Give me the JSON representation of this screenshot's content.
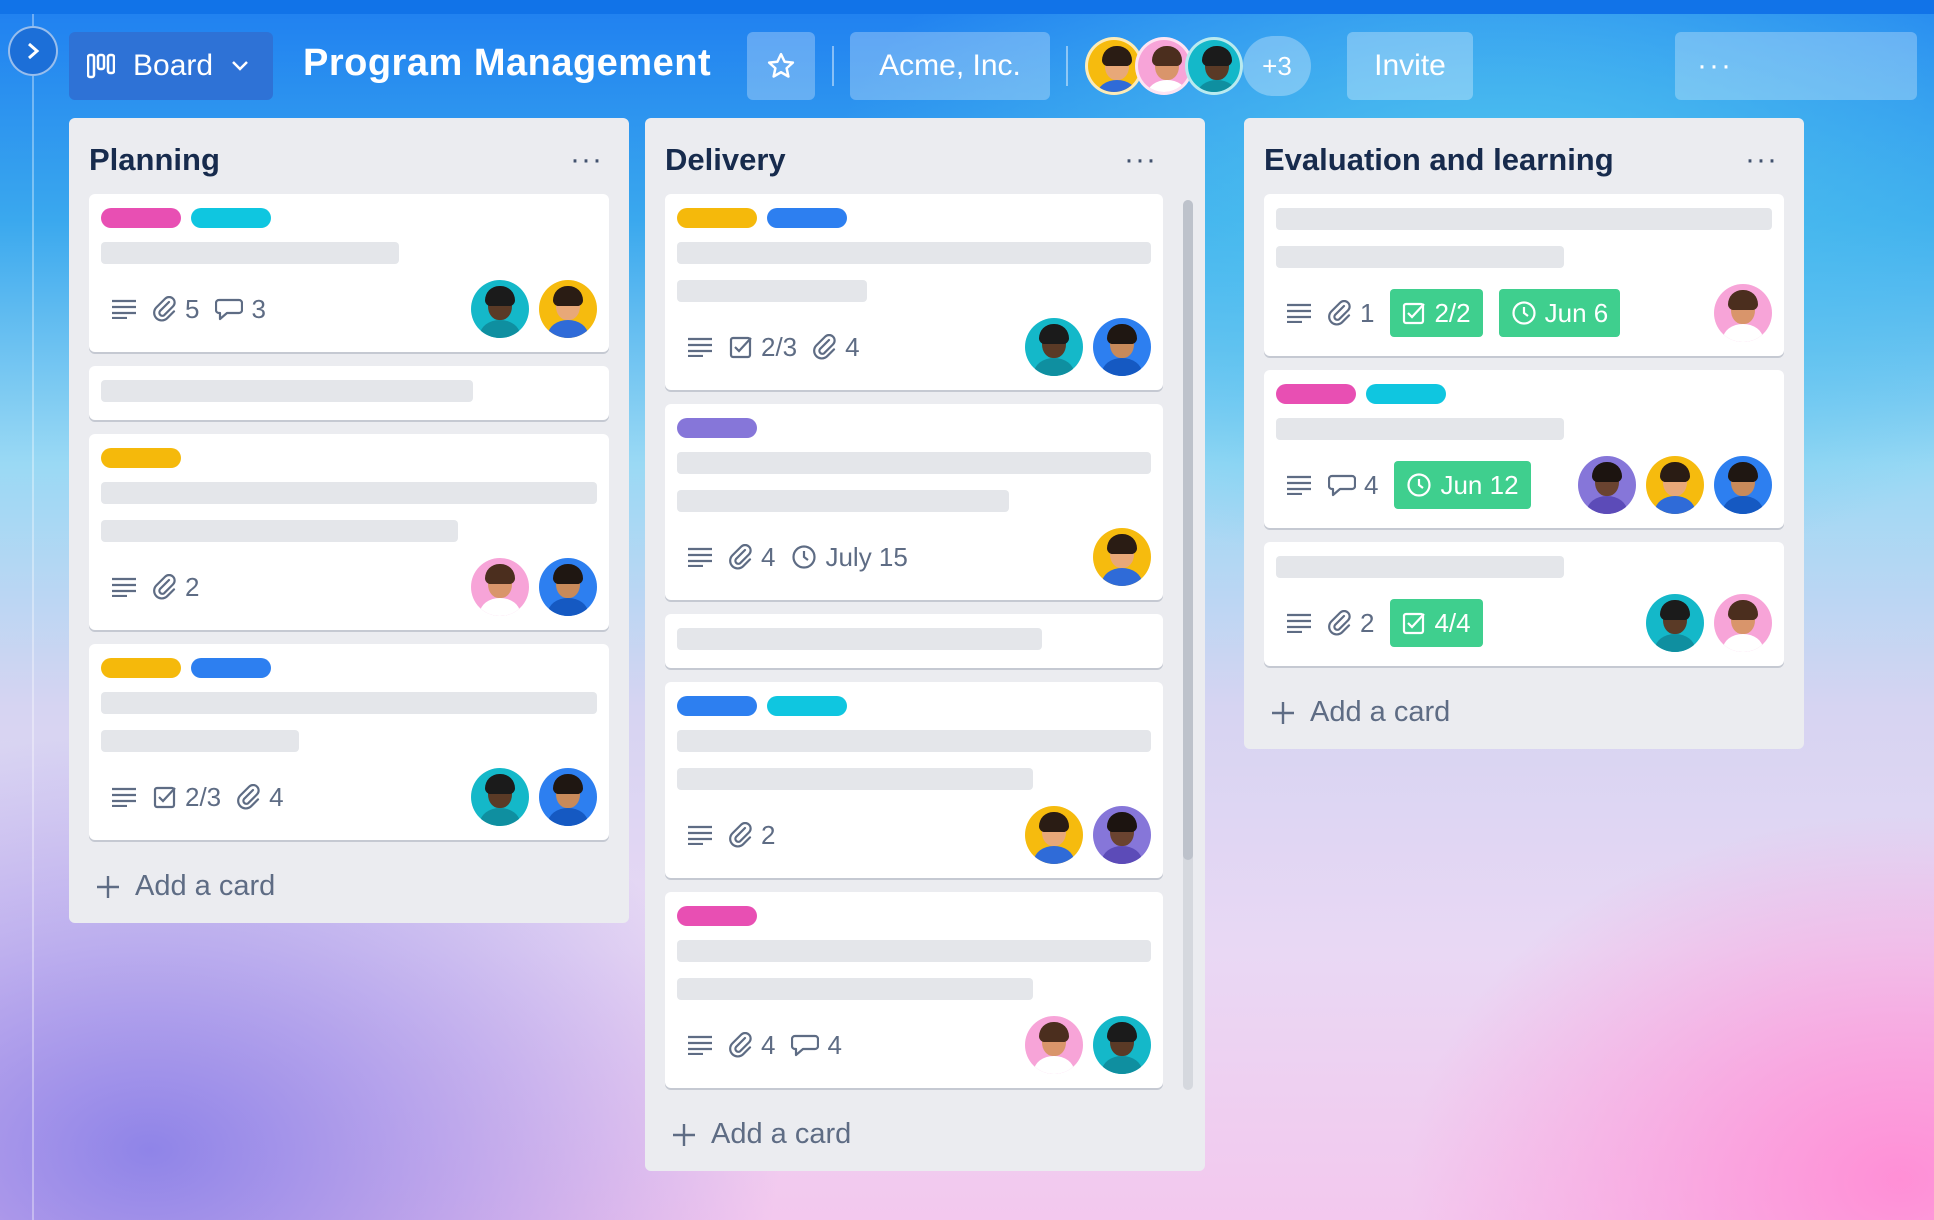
{
  "header": {
    "board_button_label": "Board",
    "board_title": "Program Management",
    "workspace_label": "Acme, Inc.",
    "extra_members": "+3",
    "invite_label": "Invite",
    "menu_label": "···"
  },
  "colors": {
    "pink": "#e84fb3",
    "cyan": "#0fc6e0",
    "yellow": "#f5b90b",
    "blue": "#2d7ff0",
    "purple": "#8676d9",
    "green": "#3fcf8e"
  },
  "lists": [
    {
      "title": "Planning",
      "menu": "···",
      "add_card": "Add a card",
      "cards": [
        {
          "labels": [
            "pink",
            "cyan"
          ],
          "lines": [
            0.6
          ],
          "badges": {
            "desc": true,
            "attach": "5",
            "comments": "3"
          },
          "avatars": [
            "teal",
            "yellow"
          ]
        },
        {
          "labels": [],
          "lines": [
            0.75
          ],
          "badges": null,
          "avatars": []
        },
        {
          "labels": [
            "yellow"
          ],
          "lines": [
            1.0,
            0.72
          ],
          "badges": {
            "desc": true,
            "attach": "2"
          },
          "avatars": [
            "pink",
            "blue"
          ]
        },
        {
          "labels": [
            "yellow",
            "blue"
          ],
          "lines": [
            1.0,
            0.4
          ],
          "badges": {
            "desc": true,
            "checklist": "2/3",
            "attach": "4"
          },
          "avatars": [
            "teal",
            "blue"
          ]
        }
      ]
    },
    {
      "title": "Delivery",
      "menu": "···",
      "add_card": "Add a card",
      "cards": [
        {
          "labels": [
            "yellow",
            "blue"
          ],
          "lines": [
            1.0,
            0.4
          ],
          "badges": {
            "desc": true,
            "checklist": "2/3",
            "attach": "4"
          },
          "avatars": [
            "teal",
            "blue"
          ]
        },
        {
          "labels": [
            "purple"
          ],
          "lines": [
            1.0,
            0.7
          ],
          "badges": {
            "desc": true,
            "attach": "4",
            "date": "July 15"
          },
          "avatars": [
            "yellow"
          ]
        },
        {
          "labels": [],
          "lines": [
            0.77
          ],
          "badges": null,
          "avatars": []
        },
        {
          "labels": [
            "blue",
            "cyan"
          ],
          "lines": [
            1.0,
            0.75
          ],
          "badges": {
            "desc": true,
            "attach": "2"
          },
          "avatars": [
            "yellow",
            "purple"
          ]
        },
        {
          "labels": [
            "pink"
          ],
          "lines": [
            1.0,
            0.75
          ],
          "badges": {
            "desc": true,
            "attach": "4",
            "comments": "4"
          },
          "avatars": [
            "pink",
            "teal"
          ]
        }
      ]
    },
    {
      "title": "Evaluation and learning",
      "menu": "···",
      "add_card": "Add a card",
      "cards": [
        {
          "labels": [],
          "lines": [
            1.0,
            0.58
          ],
          "badges": {
            "desc": true,
            "attach": "1",
            "checklist_done": "2/2",
            "due": "Jun 6"
          },
          "avatars": [
            "pink"
          ]
        },
        {
          "labels": [
            "pink",
            "cyan"
          ],
          "lines": [
            0.58
          ],
          "badges": {
            "desc": true,
            "comments": "4",
            "due": "Jun 12"
          },
          "avatars": [
            "purple",
            "yellow",
            "blue"
          ]
        },
        {
          "labels": [],
          "lines": [
            0.58
          ],
          "badges": {
            "desc": true,
            "attach": "2",
            "checklist_done": "4/4"
          },
          "avatars": [
            "teal",
            "pink"
          ]
        }
      ]
    }
  ]
}
